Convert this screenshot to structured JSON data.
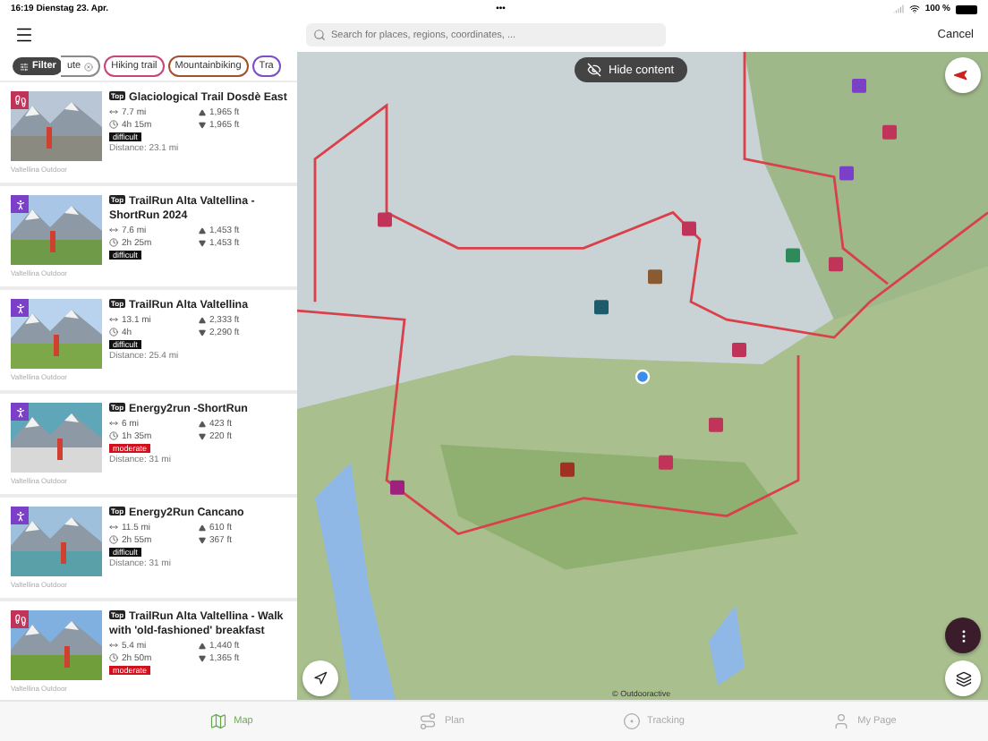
{
  "status_bar": {
    "time": "16:19",
    "date": "Dienstag 23. Apr.",
    "dots": "•••",
    "battery": "100 %"
  },
  "search": {
    "placeholder": "Search for places, regions, coordinates, ...",
    "cancel": "Cancel"
  },
  "filter": {
    "label": "Filter"
  },
  "chips": [
    {
      "label": "ute",
      "color": "#8a8a8a",
      "removable": true
    },
    {
      "label": "Hiking trail",
      "color": "#c8457a",
      "removable": false
    },
    {
      "label": "Mountainbiking",
      "color": "#a0522d",
      "removable": false
    },
    {
      "label": "Tra",
      "color": "#7b4fc8",
      "removable": false
    }
  ],
  "tours": [
    {
      "kind": "hiking",
      "color": "#c0345a",
      "badge": "Top",
      "title": "Glaciological Trail Dosdè East",
      "length": "7.7 mi",
      "ascent": "1,965 ft",
      "duration": "4h 15m",
      "descent": "1,965 ft",
      "difficulty": "difficult",
      "distance": "Distance: 23.1 mi",
      "source": "Valtellina Outdoor"
    },
    {
      "kind": "running",
      "color": "#7b3fc8",
      "badge": "Top",
      "title": "TrailRun Alta Valtellina - ShortRun 2024",
      "length": "7.6 mi",
      "ascent": "1,453 ft",
      "duration": "2h 25m",
      "descent": "1,453 ft",
      "difficulty": "difficult",
      "source": "Valtellina Outdoor"
    },
    {
      "kind": "running",
      "color": "#7b3fc8",
      "badge": "Top",
      "title": "TrailRun Alta Valtellina",
      "length": "13.1 mi",
      "ascent": "2,333 ft",
      "duration": "4h",
      "descent": "2,290 ft",
      "difficulty": "difficult",
      "distance": "Distance: 25.4 mi",
      "source": "Valtellina Outdoor"
    },
    {
      "kind": "running",
      "color": "#7b3fc8",
      "badge": "Top",
      "title": "Energy2run -ShortRun",
      "length": "6 mi",
      "ascent": "423 ft",
      "duration": "1h 35m",
      "descent": "220 ft",
      "difficulty": "moderate",
      "distance": "Distance: 31 mi",
      "source": "Valtellina Outdoor"
    },
    {
      "kind": "running",
      "color": "#7b3fc8",
      "badge": "Top",
      "title": "Energy2Run Cancano",
      "length": "11.5 mi",
      "ascent": "610 ft",
      "duration": "2h 55m",
      "descent": "367 ft",
      "difficulty": "difficult",
      "distance": "Distance: 31 mi",
      "source": "Valtellina Outdoor"
    },
    {
      "kind": "hiking",
      "color": "#c0345a",
      "badge": "Top",
      "title": "TrailRun Alta Valtellina - Walk with 'old-fashioned' breakfast",
      "length": "5.4 mi",
      "ascent": "1,440 ft",
      "duration": "2h 50m",
      "descent": "1,365 ft",
      "difficulty": "moderate",
      "source": "Valtellina Outdoor"
    }
  ],
  "map": {
    "hide_button": "Hide content",
    "attribution": "© Outdooractive"
  },
  "tabs": [
    {
      "kind": "map",
      "label": "Map",
      "selected": true
    },
    {
      "kind": "plan",
      "label": "Plan",
      "selected": false
    },
    {
      "kind": "tracking",
      "label": "Tracking",
      "selected": false
    },
    {
      "kind": "profile",
      "label": "My Page",
      "selected": false
    }
  ]
}
